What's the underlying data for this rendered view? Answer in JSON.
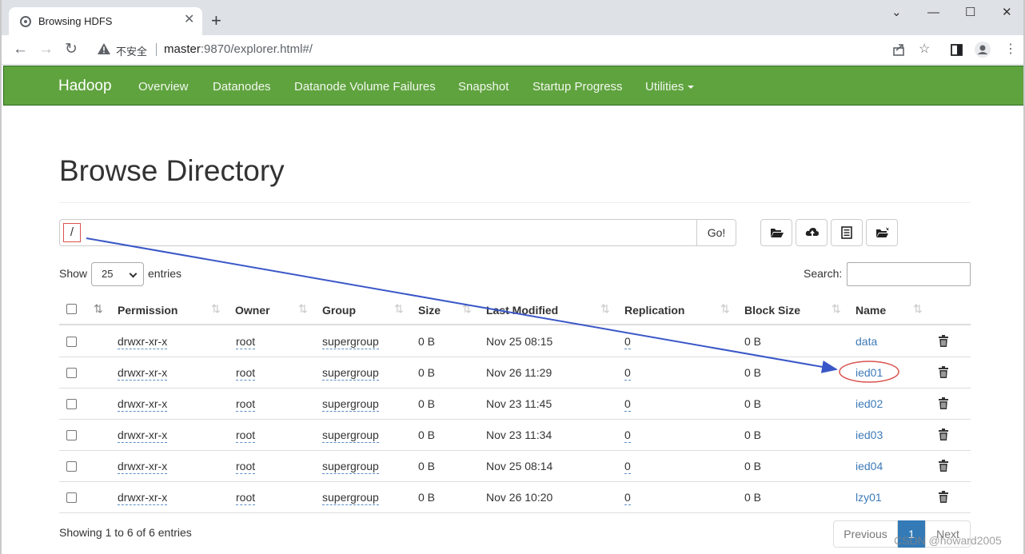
{
  "browser": {
    "tab_title": "Browsing HDFS",
    "tab_close": "✕",
    "new_tab": "+",
    "window_controls": [
      "⌄",
      "—",
      "☐",
      "✕"
    ],
    "security_label": "不安全",
    "url_host": "master",
    "url_rest": ":9870/explorer.html#/"
  },
  "navbar": {
    "brand": "Hadoop",
    "links": [
      "Overview",
      "Datanodes",
      "Datanode Volume Failures",
      "Snapshot",
      "Startup Progress",
      "Utilities"
    ]
  },
  "page": {
    "title": "Browse Directory",
    "path_value": "/",
    "go_label": "Go!",
    "show_label": "Show",
    "entries_value": "25",
    "entries_label": "entries",
    "search_label": "Search:"
  },
  "table": {
    "columns": [
      "Permission",
      "Owner",
      "Group",
      "Size",
      "Last Modified",
      "Replication",
      "Block Size",
      "Name"
    ],
    "rows": [
      {
        "permission": "drwxr-xr-x",
        "owner": "root",
        "group": "supergroup",
        "size": "0 B",
        "modified": "Nov 25 08:15",
        "replication": "0",
        "block_size": "0 B",
        "name": "data"
      },
      {
        "permission": "drwxr-xr-x",
        "owner": "root",
        "group": "supergroup",
        "size": "0 B",
        "modified": "Nov 26 11:29",
        "replication": "0",
        "block_size": "0 B",
        "name": "ied01"
      },
      {
        "permission": "drwxr-xr-x",
        "owner": "root",
        "group": "supergroup",
        "size": "0 B",
        "modified": "Nov 23 11:45",
        "replication": "0",
        "block_size": "0 B",
        "name": "ied02"
      },
      {
        "permission": "drwxr-xr-x",
        "owner": "root",
        "group": "supergroup",
        "size": "0 B",
        "modified": "Nov 23 11:34",
        "replication": "0",
        "block_size": "0 B",
        "name": "ied03"
      },
      {
        "permission": "drwxr-xr-x",
        "owner": "root",
        "group": "supergroup",
        "size": "0 B",
        "modified": "Nov 25 08:14",
        "replication": "0",
        "block_size": "0 B",
        "name": "ied04"
      },
      {
        "permission": "drwxr-xr-x",
        "owner": "root",
        "group": "supergroup",
        "size": "0 B",
        "modified": "Nov 26 10:20",
        "replication": "0",
        "block_size": "0 B",
        "name": "lzy01"
      }
    ]
  },
  "footer": {
    "info": "Showing 1 to 6 of 6 entries",
    "previous": "Previous",
    "current_page": "1",
    "next": "Next"
  },
  "watermark": "CSDN @howard2005",
  "colors": {
    "navbar_green": "#5fa33e",
    "link_blue": "#3d7ab8",
    "annotation_red": "#d9534f",
    "annotation_arrow": "#3a57c8"
  }
}
